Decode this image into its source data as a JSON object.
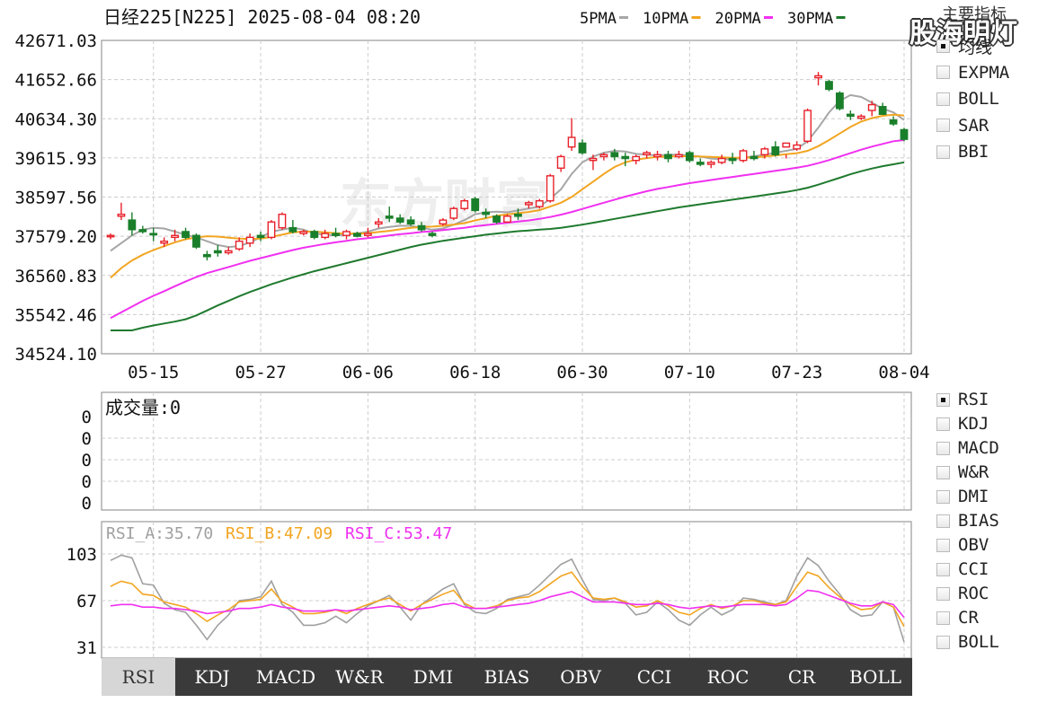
{
  "header": {
    "title": "日经225[N225] 2025-08-04 08:20",
    "ma_legend": [
      {
        "label": "5PMA",
        "color": "#a6a6a6"
      },
      {
        "label": "10PMA",
        "color": "#f2a521"
      },
      {
        "label": "20PMA",
        "color": "#f030f0"
      },
      {
        "label": "30PMA",
        "color": "#1f7a2e"
      }
    ]
  },
  "brand": "股海明灯",
  "side_heading": "主要指标",
  "main_indicators": [
    {
      "label": "均线",
      "checked": true
    },
    {
      "label": "EXPMA",
      "checked": false
    },
    {
      "label": "BOLL",
      "checked": false
    },
    {
      "label": "SAR",
      "checked": false
    },
    {
      "label": "BBI",
      "checked": false
    }
  ],
  "sub_indicators": [
    {
      "label": "RSI",
      "checked": true
    },
    {
      "label": "KDJ",
      "checked": false
    },
    {
      "label": "MACD",
      "checked": false
    },
    {
      "label": "W&R",
      "checked": false
    },
    {
      "label": "DMI",
      "checked": false
    },
    {
      "label": "BIAS",
      "checked": false
    },
    {
      "label": "OBV",
      "checked": false
    },
    {
      "label": "CCI",
      "checked": false
    },
    {
      "label": "ROC",
      "checked": false
    },
    {
      "label": "CR",
      "checked": false
    },
    {
      "label": "BOLL",
      "checked": false
    }
  ],
  "tabs": [
    "RSI",
    "KDJ",
    "MACD",
    "W&R",
    "DMI",
    "BIAS",
    "OBV",
    "CCI",
    "ROC",
    "CR",
    "BOLL"
  ],
  "active_tab": "RSI",
  "colors": {
    "up": "#e8212a",
    "down": "#1a7f2b",
    "grid": "#c8c8c8"
  },
  "chart_data": [
    {
      "type": "candlestick",
      "yticks": [
        "42671.03",
        "41652.66",
        "40634.30",
        "39615.93",
        "38597.56",
        "37579.20",
        "36560.83",
        "35542.46",
        "34524.10"
      ],
      "ylim": [
        34524.1,
        42671.03
      ],
      "xticks": [
        "05-15",
        "05-27",
        "06-06",
        "06-18",
        "06-30",
        "07-10",
        "07-23",
        "08-04"
      ],
      "xtick_index": [
        4,
        14,
        24,
        34,
        44,
        54,
        64,
        74
      ],
      "candles": [
        [
          37580,
          37650,
          37500,
          37600
        ],
        [
          38100,
          38450,
          38000,
          38150
        ],
        [
          38000,
          38200,
          37600,
          37750
        ],
        [
          37750,
          37850,
          37650,
          37700
        ],
        [
          37650,
          37800,
          37450,
          37620
        ],
        [
          37400,
          37550,
          37300,
          37450
        ],
        [
          37550,
          37750,
          37450,
          37600
        ],
        [
          37700,
          37800,
          37500,
          37550
        ],
        [
          37600,
          37650,
          37250,
          37300
        ],
        [
          37100,
          37200,
          36950,
          37050
        ],
        [
          37200,
          37350,
          37050,
          37150
        ],
        [
          37150,
          37300,
          37100,
          37200
        ],
        [
          37250,
          37550,
          37200,
          37450
        ],
        [
          37400,
          37650,
          37300,
          37550
        ],
        [
          37600,
          37700,
          37450,
          37550
        ],
        [
          37550,
          38000,
          37500,
          37950
        ],
        [
          37800,
          38200,
          37750,
          38150
        ],
        [
          37800,
          38000,
          37650,
          37700
        ],
        [
          37650,
          37750,
          37600,
          37700
        ],
        [
          37700,
          37750,
          37500,
          37550
        ],
        [
          37550,
          37750,
          37500,
          37650
        ],
        [
          37650,
          37800,
          37550,
          37600
        ],
        [
          37600,
          37750,
          37500,
          37700
        ],
        [
          37650,
          37700,
          37550,
          37580
        ],
        [
          37600,
          37800,
          37550,
          37650
        ],
        [
          37900,
          38050,
          37800,
          37950
        ],
        [
          38100,
          38350,
          37950,
          38050
        ],
        [
          38050,
          38150,
          37900,
          37950
        ],
        [
          38000,
          38100,
          37850,
          37900
        ],
        [
          37850,
          37950,
          37700,
          37750
        ],
        [
          37650,
          37700,
          37550,
          37600
        ],
        [
          37900,
          38050,
          37850,
          38000
        ],
        [
          38050,
          38350,
          38000,
          38300
        ],
        [
          38300,
          38550,
          38250,
          38500
        ],
        [
          38550,
          38600,
          38200,
          38250
        ],
        [
          38200,
          38300,
          38050,
          38150
        ],
        [
          38100,
          38150,
          37900,
          37950
        ],
        [
          37950,
          38150,
          37950,
          38100
        ],
        [
          38150,
          38300,
          38000,
          38100
        ],
        [
          38400,
          38500,
          38300,
          38450
        ],
        [
          38350,
          38550,
          38300,
          38500
        ],
        [
          38500,
          39200,
          38450,
          39150
        ],
        [
          39350,
          39700,
          39250,
          39650
        ],
        [
          39900,
          40650,
          39800,
          40150
        ],
        [
          40000,
          40100,
          39700,
          39750
        ],
        [
          39550,
          39700,
          39300,
          39600
        ],
        [
          39650,
          39750,
          39550,
          39700
        ],
        [
          39750,
          39850,
          39550,
          39650
        ],
        [
          39650,
          39750,
          39400,
          39600
        ],
        [
          39550,
          39700,
          39450,
          39650
        ],
        [
          39700,
          39800,
          39600,
          39750
        ],
        [
          39650,
          39800,
          39550,
          39700
        ],
        [
          39700,
          39800,
          39500,
          39600
        ],
        [
          39650,
          39800,
          39600,
          39700
        ],
        [
          39750,
          39800,
          39500,
          39550
        ],
        [
          39500,
          39600,
          39400,
          39450
        ],
        [
          39450,
          39550,
          39350,
          39500
        ],
        [
          39500,
          39700,
          39450,
          39600
        ],
        [
          39600,
          39750,
          39450,
          39550
        ],
        [
          39550,
          39850,
          39500,
          39800
        ],
        [
          39650,
          39800,
          39550,
          39600
        ],
        [
          39700,
          39900,
          39600,
          39850
        ],
        [
          39900,
          40050,
          39650,
          39700
        ],
        [
          39900,
          39700,
          39600,
          40000
        ],
        [
          39850,
          40050,
          39800,
          39950
        ],
        [
          40050,
          40900,
          40000,
          40850
        ],
        [
          41700,
          41850,
          41500,
          41750
        ],
        [
          41600,
          41650,
          41350,
          41400
        ],
        [
          41300,
          41350,
          40850,
          40900
        ],
        [
          40750,
          40850,
          40600,
          40700
        ],
        [
          40650,
          40750,
          40600,
          40700
        ],
        [
          40850,
          41100,
          40700,
          41000
        ],
        [
          40950,
          41050,
          40750,
          40750
        ],
        [
          40600,
          40700,
          40450,
          40500
        ],
        [
          40350,
          40400,
          40050,
          40100
        ]
      ],
      "ma": {
        "5PMA": [
          37200,
          37400,
          37600,
          37750,
          37800,
          37780,
          37700,
          37620,
          37550,
          37450,
          37350,
          37300,
          37320,
          37420,
          37550,
          37700,
          37750,
          37800,
          37750,
          37650,
          37620,
          37600,
          37620,
          37650,
          37700,
          37780,
          37820,
          37850,
          37850,
          37800,
          37750,
          37780,
          37880,
          38000,
          38150,
          38200,
          38220,
          38200,
          38250,
          38300,
          38350,
          38550,
          38800,
          39200,
          39500,
          39650,
          39750,
          39800,
          39780,
          39720,
          39700,
          39680,
          39700,
          39700,
          39680,
          39650,
          39600,
          39580,
          39580,
          39620,
          39660,
          39700,
          39750,
          39800,
          39850,
          40050,
          40400,
          40800,
          41100,
          41250,
          41200,
          41050,
          40900,
          40800,
          40600
        ],
        "10PMA": [
          36500,
          36750,
          36950,
          37100,
          37220,
          37320,
          37420,
          37500,
          37550,
          37580,
          37570,
          37540,
          37520,
          37510,
          37520,
          37560,
          37620,
          37680,
          37700,
          37700,
          37680,
          37660,
          37650,
          37650,
          37660,
          37690,
          37720,
          37760,
          37800,
          37820,
          37830,
          37850,
          37880,
          37920,
          37990,
          38050,
          38110,
          38150,
          38180,
          38210,
          38260,
          38350,
          38450,
          38600,
          38800,
          39000,
          39200,
          39380,
          39500,
          39570,
          39610,
          39640,
          39650,
          39660,
          39660,
          39650,
          39640,
          39630,
          39620,
          39620,
          39630,
          39650,
          39680,
          39710,
          39740,
          39800,
          39920,
          40080,
          40250,
          40420,
          40560,
          40650,
          40710,
          40740,
          40720
        ],
        "20PMA": [
          35450,
          35600,
          35750,
          35900,
          36030,
          36150,
          36280,
          36400,
          36520,
          36620,
          36700,
          36780,
          36860,
          36940,
          37010,
          37080,
          37150,
          37220,
          37280,
          37330,
          37380,
          37420,
          37460,
          37500,
          37530,
          37560,
          37600,
          37630,
          37660,
          37690,
          37710,
          37740,
          37770,
          37800,
          37840,
          37870,
          37900,
          37930,
          37960,
          37990,
          38030,
          38080,
          38140,
          38210,
          38290,
          38370,
          38450,
          38530,
          38610,
          38680,
          38750,
          38810,
          38860,
          38910,
          38960,
          39000,
          39040,
          39080,
          39120,
          39160,
          39200,
          39240,
          39280,
          39320,
          39360,
          39410,
          39480,
          39560,
          39650,
          39740,
          39830,
          39910,
          39980,
          40050,
          40080
        ],
        "30PMA": [
          35130,
          35130,
          35130,
          35200,
          35260,
          35310,
          35360,
          35420,
          35520,
          35650,
          35780,
          35900,
          36020,
          36130,
          36230,
          36330,
          36420,
          36510,
          36590,
          36670,
          36740,
          36810,
          36880,
          36950,
          37020,
          37090,
          37160,
          37230,
          37300,
          37360,
          37410,
          37460,
          37500,
          37540,
          37580,
          37620,
          37650,
          37680,
          37710,
          37730,
          37750,
          37770,
          37800,
          37840,
          37880,
          37930,
          37980,
          38030,
          38080,
          38130,
          38180,
          38230,
          38280,
          38330,
          38370,
          38410,
          38450,
          38490,
          38530,
          38570,
          38610,
          38650,
          38690,
          38730,
          38780,
          38840,
          38920,
          39010,
          39100,
          39190,
          39270,
          39340,
          39400,
          39450,
          39500
        ]
      }
    },
    {
      "type": "bar",
      "title": "成交量:0",
      "yticks": [
        "0",
        "0",
        "0",
        "0",
        "0"
      ],
      "values": []
    },
    {
      "type": "line",
      "yticks": [
        "103",
        "67",
        "31"
      ],
      "ylim": [
        31,
        103
      ],
      "series": [
        {
          "name": "RSI_A:35.70",
          "color": "#a0a0a0",
          "values": [
            98,
            102,
            100,
            80,
            79,
            65,
            60,
            58,
            48,
            37,
            48,
            56,
            67,
            68,
            70,
            82,
            64,
            58,
            48,
            48,
            50,
            55,
            50,
            57,
            63,
            67,
            71,
            62,
            52,
            64,
            70,
            76,
            80,
            64,
            58,
            57,
            61,
            68,
            70,
            72,
            79,
            87,
            95,
            99,
            83,
            68,
            67,
            69,
            65,
            56,
            58,
            66,
            60,
            52,
            48,
            56,
            62,
            56,
            60,
            69,
            68,
            66,
            64,
            67,
            86,
            100,
            94,
            82,
            72,
            60,
            55,
            56,
            66,
            62,
            35
          ]
        },
        {
          "name": "RSI_B:47.09",
          "color": "#f2a521",
          "values": [
            78,
            82,
            80,
            72,
            71,
            66,
            64,
            62,
            57,
            51,
            56,
            60,
            66,
            67,
            68,
            76,
            66,
            62,
            57,
            57,
            58,
            60,
            57,
            61,
            64,
            67,
            69,
            64,
            59,
            64,
            68,
            72,
            75,
            65,
            61,
            61,
            63,
            67,
            69,
            70,
            74,
            80,
            86,
            89,
            78,
            69,
            68,
            69,
            66,
            62,
            63,
            67,
            63,
            58,
            56,
            61,
            64,
            61,
            63,
            67,
            67,
            65,
            64,
            66,
            78,
            89,
            86,
            77,
            70,
            64,
            60,
            61,
            66,
            62,
            47
          ]
        },
        {
          "name": "RSI_C:53.47",
          "color": "#f030f0",
          "values": [
            63,
            64,
            64,
            62,
            62,
            61,
            61,
            60,
            59,
            57,
            58,
            59,
            61,
            61,
            62,
            64,
            62,
            61,
            59,
            59,
            59,
            60,
            59,
            60,
            61,
            62,
            63,
            62,
            60,
            61,
            62,
            64,
            65,
            62,
            61,
            61,
            62,
            63,
            64,
            65,
            67,
            70,
            72,
            74,
            70,
            66,
            66,
            66,
            65,
            64,
            64,
            65,
            64,
            62,
            61,
            62,
            63,
            62,
            63,
            64,
            64,
            64,
            63,
            64,
            69,
            75,
            74,
            71,
            68,
            65,
            63,
            63,
            66,
            64,
            54
          ]
        }
      ]
    }
  ]
}
